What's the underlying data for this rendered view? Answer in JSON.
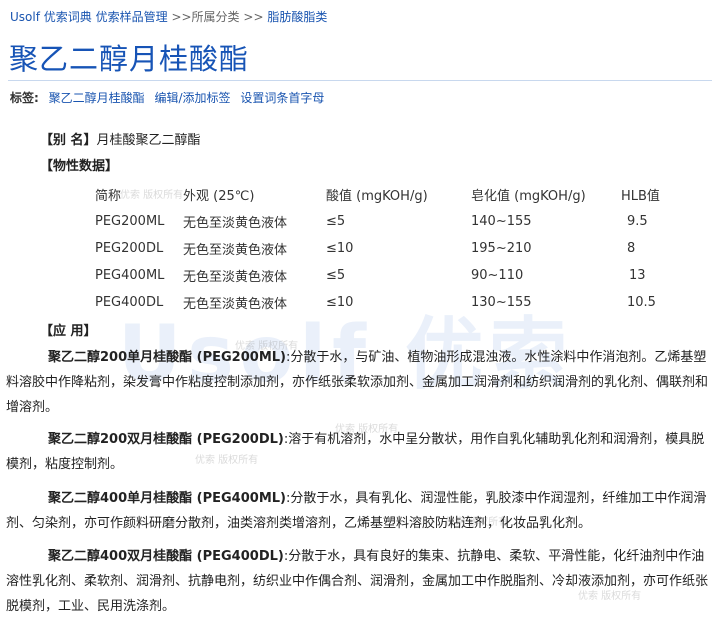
{
  "breadcrumb": {
    "items": [
      {
        "label": "Usolf 优索词典",
        "link": true
      },
      {
        "label": "优索样品管理",
        "link": true
      },
      {
        "label": ">>所属分类",
        "link": false
      },
      {
        "label": ">>",
        "link": false
      },
      {
        "label": "脂肪酸脂类",
        "link": true
      }
    ]
  },
  "title": "聚乙二醇月桂酸酯",
  "tags": {
    "label": "标签:",
    "items": [
      "聚乙二醇月桂酸酯",
      "编辑/添加标签",
      "设置词条首字母"
    ]
  },
  "alias": {
    "label": "【别  名】",
    "value": "月桂酸聚乙二醇酯"
  },
  "properties": {
    "heading": "【物性数据】",
    "columns": [
      "简称",
      "外观 (25℃)",
      "酸值 (mgKOH/g)",
      "皂化值 (mgKOH/g)",
      "HLB值"
    ],
    "rows": [
      [
        "PEG200ML",
        "无色至淡黄色液体",
        "≤5",
        "140~155",
        "9.5"
      ],
      [
        "PEG200DL",
        "无色至淡黄色液体",
        "≤10",
        "195~210",
        "8"
      ],
      [
        "PEG400ML",
        "无色至淡黄色液体",
        "≤5",
        "90~110",
        "13"
      ],
      [
        "PEG400DL",
        "无色至淡黄色液体",
        "≤10",
        "130~155",
        "10.5"
      ]
    ]
  },
  "application": {
    "heading": "【应  用】",
    "items": [
      {
        "name": "聚乙二醇200单月桂酸酯 (PEG200ML)",
        "text": ":分散于水，与矿油、植物油形成混浊液。水性涂料中作消泡剂。乙烯基塑料溶胶中作降粘剂，染发膏中作粘度控制添加剂，亦作纸张柔软添加剂、金属加工润滑剂和纺织润滑剂的乳化剂、偶联剂和增溶剂。"
      },
      {
        "name": "聚乙二醇200双月桂酸酯 (PEG200DL)",
        "text": ":溶于有机溶剂，水中呈分散状，用作自乳化辅助乳化剂和润滑剂，模具脱模剂，粘度控制剂。"
      },
      {
        "name": "聚乙二醇400单月桂酸酯 (PEG400ML)",
        "text": ":分散于水，具有乳化、润湿性能，乳胶漆中作润湿剂，纤维加工中作润滑剂、匀染剂，亦可作颜料研磨分散剂，油类溶剂类增溶剂，乙烯基塑料溶胶防粘连剂，化妆品乳化剂。"
      },
      {
        "name": "聚乙二醇400双月桂酸酯 (PEG400DL)",
        "text": ":分散于水，具有良好的集束、抗静电、柔软、平滑性能，化纤油剂中作油溶性乳化剂、柔软剂、润滑剂、抗静电剂，纺织业中作偶合剂、润滑剂，金属加工中作脱脂剂、冷却液添加剂，亦可作纸张脱模剂，工业、民用洗涤剂。"
      }
    ]
  },
  "watermark": {
    "large": "Usolf 优索",
    "small": "优索 版权所有"
  },
  "colors": {
    "link": "#1a55b0",
    "title": "#1754b6"
  }
}
